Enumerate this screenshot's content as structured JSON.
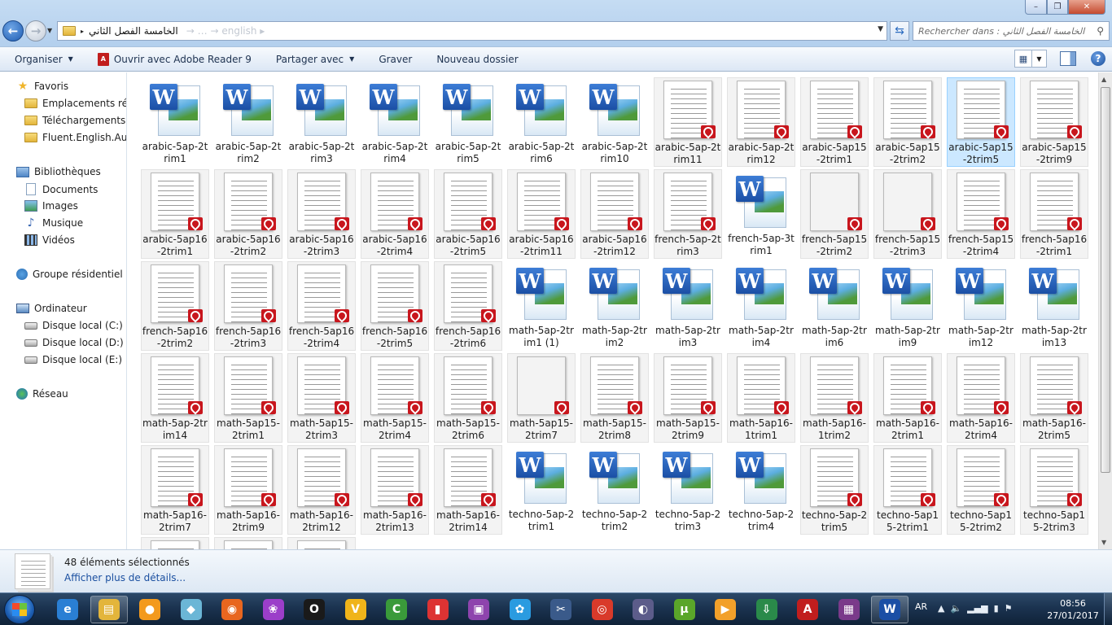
{
  "window": {
    "min_glyph": "–",
    "max_glyph": "❐",
    "close_glyph": "✕"
  },
  "address": {
    "path": "الخامسة الفصل الثاني",
    "ghost": "→ … → english ▸",
    "search_placeholder": "Rechercher dans : الخامسة الفصل الثاني"
  },
  "toolbar": {
    "organize": "Organiser",
    "open_with": "Ouvrir avec Adobe Reader 9",
    "share": "Partager avec",
    "burn": "Graver",
    "new_folder": "Nouveau dossier"
  },
  "sidebar": {
    "favorites": "Favoris",
    "recent": "Emplacements récents",
    "downloads": "Téléchargements",
    "fluent": "Fluent.English.Audio",
    "libraries": "Bibliothèques",
    "documents": "Documents",
    "images": "Images",
    "music": "Musique",
    "videos": "Vidéos",
    "homegroup": "Groupe résidentiel",
    "computer": "Ordinateur",
    "disk_c": "Disque local (C:)",
    "disk_d": "Disque local (D:)",
    "disk_e": "Disque local (E:)",
    "network": "Réseau"
  },
  "files": [
    {
      "name": "arabic-5ap-2trim1",
      "type": "word"
    },
    {
      "name": "arabic-5ap-2trim2",
      "type": "word"
    },
    {
      "name": "arabic-5ap-2trim3",
      "type": "word"
    },
    {
      "name": "arabic-5ap-2trim4",
      "type": "word"
    },
    {
      "name": "arabic-5ap-2trim5",
      "type": "word"
    },
    {
      "name": "arabic-5ap-2trim6",
      "type": "word"
    },
    {
      "name": "arabic-5ap-2trim10",
      "type": "word"
    },
    {
      "name": "arabic-5ap-2trim11",
      "type": "pdf"
    },
    {
      "name": "arabic-5ap-2trim12",
      "type": "pdf"
    },
    {
      "name": "arabic-5ap15-2trim1",
      "type": "pdf"
    },
    {
      "name": "arabic-5ap15-2trim2",
      "type": "pdf"
    },
    {
      "name": "arabic-5ap15-2trim5",
      "type": "pdf",
      "selected": true
    },
    {
      "name": "arabic-5ap15-2trim9",
      "type": "pdf"
    },
    {
      "name": "arabic-5ap16-2trim1",
      "type": "pdf"
    },
    {
      "name": "arabic-5ap16-2trim2",
      "type": "pdf"
    },
    {
      "name": "arabic-5ap16-2trim3",
      "type": "pdf"
    },
    {
      "name": "arabic-5ap16-2trim4",
      "type": "pdf"
    },
    {
      "name": "arabic-5ap16-2trim5",
      "type": "pdf"
    },
    {
      "name": "arabic-5ap16-2trim11",
      "type": "pdf"
    },
    {
      "name": "arabic-5ap16-2trim12",
      "type": "pdf"
    },
    {
      "name": "french-5ap-2trim3",
      "type": "pdf"
    },
    {
      "name": "french-5ap-3trim1",
      "type": "word"
    },
    {
      "name": "french-5ap15-2trim2",
      "type": "pdf",
      "thumb": "blue"
    },
    {
      "name": "french-5ap15-2trim3",
      "type": "pdf",
      "thumb": "green"
    },
    {
      "name": "french-5ap15-2trim4",
      "type": "pdf"
    },
    {
      "name": "french-5ap16-2trim1",
      "type": "pdf"
    },
    {
      "name": "french-5ap16-2trim2",
      "type": "pdf"
    },
    {
      "name": "french-5ap16-2trim3",
      "type": "pdf"
    },
    {
      "name": "french-5ap16-2trim4",
      "type": "pdf"
    },
    {
      "name": "french-5ap16-2trim5",
      "type": "pdf"
    },
    {
      "name": "french-5ap16-2trim6",
      "type": "pdf"
    },
    {
      "name": "math-5ap-2trim1 (1)",
      "type": "word"
    },
    {
      "name": "math-5ap-2trim2",
      "type": "word"
    },
    {
      "name": "math-5ap-2trim3",
      "type": "word"
    },
    {
      "name": "math-5ap-2trim4",
      "type": "word"
    },
    {
      "name": "math-5ap-2trim6",
      "type": "word"
    },
    {
      "name": "math-5ap-2trim9",
      "type": "word"
    },
    {
      "name": "math-5ap-2trim12",
      "type": "word"
    },
    {
      "name": "math-5ap-2trim13",
      "type": "word"
    },
    {
      "name": "math-5ap-2trim14",
      "type": "pdf"
    },
    {
      "name": "math-5ap15-2trim1",
      "type": "pdf"
    },
    {
      "name": "math-5ap15-2trim3",
      "type": "pdf"
    },
    {
      "name": "math-5ap15-2trim4",
      "type": "pdf"
    },
    {
      "name": "math-5ap15-2trim6",
      "type": "pdf"
    },
    {
      "name": "math-5ap15-2trim7",
      "type": "pdf",
      "thumb": "blue"
    },
    {
      "name": "math-5ap15-2trim8",
      "type": "pdf"
    },
    {
      "name": "math-5ap15-2trim9",
      "type": "pdf"
    },
    {
      "name": "math-5ap16-1trim1",
      "type": "pdf"
    },
    {
      "name": "math-5ap16-1trim2",
      "type": "pdf"
    },
    {
      "name": "math-5ap16-2trim1",
      "type": "pdf"
    },
    {
      "name": "math-5ap16-2trim4",
      "type": "pdf"
    },
    {
      "name": "math-5ap16-2trim5",
      "type": "pdf"
    },
    {
      "name": "math-5ap16-2trim7",
      "type": "pdf"
    },
    {
      "name": "math-5ap16-2trim9",
      "type": "pdf"
    },
    {
      "name": "math-5ap16-2trim12",
      "type": "pdf"
    },
    {
      "name": "math-5ap16-2trim13",
      "type": "pdf"
    },
    {
      "name": "math-5ap16-2trim14",
      "type": "pdf"
    },
    {
      "name": "techno-5ap-2trim1",
      "type": "word"
    },
    {
      "name": "techno-5ap-2trim2",
      "type": "word"
    },
    {
      "name": "techno-5ap-2trim3",
      "type": "word"
    },
    {
      "name": "techno-5ap-2trim4",
      "type": "word"
    },
    {
      "name": "techno-5ap-2trim5",
      "type": "pdf"
    },
    {
      "name": "techno-5ap15-2trim1",
      "type": "pdf"
    },
    {
      "name": "techno-5ap15-2trim2",
      "type": "pdf"
    },
    {
      "name": "techno-5ap15-2trim3",
      "type": "pdf"
    },
    {
      "name": "",
      "type": "pdf"
    },
    {
      "name": "",
      "type": "pdf"
    },
    {
      "name": "",
      "type": "pdf"
    }
  ],
  "details": {
    "count": "48 éléments sélectionnés",
    "more": "Afficher plus de détails..."
  },
  "taskbar": {
    "lang": "AR",
    "time": "08:56",
    "date": "27/01/2017",
    "apps": [
      {
        "icon": "internet-explorer-icon",
        "glyph": "e",
        "color": "#2a7fd4"
      },
      {
        "icon": "file-explorer-icon",
        "glyph": "▤",
        "color": "#e3b53b",
        "active": true
      },
      {
        "icon": "ball-app-icon",
        "glyph": "●",
        "color": "#f39a1e"
      },
      {
        "icon": "notes-app-icon",
        "glyph": "◆",
        "color": "#6bb6d6"
      },
      {
        "icon": "firefox-icon",
        "glyph": "◉",
        "color": "#e8661f"
      },
      {
        "icon": "picasa-icon",
        "glyph": "❀",
        "color": "#9b3ec9"
      },
      {
        "icon": "opera-icon",
        "glyph": "O",
        "color": "#1a1a1a"
      },
      {
        "icon": "v-app-icon",
        "glyph": "V",
        "color": "#f0b41a"
      },
      {
        "icon": "camtasia-icon",
        "glyph": "C",
        "color": "#3a9a3a"
      },
      {
        "icon": "usb-app-icon",
        "glyph": "▮",
        "color": "#d33"
      },
      {
        "icon": "form-app-icon",
        "glyph": "▣",
        "color": "#8e44ad"
      },
      {
        "icon": "shareit-icon",
        "glyph": "✿",
        "color": "#2a9be0"
      },
      {
        "icon": "scissors-icon",
        "glyph": "✂",
        "color": "#3a5a8a"
      },
      {
        "icon": "chrome-icon",
        "glyph": "◎",
        "color": "#d93a2a"
      },
      {
        "icon": "media-app-icon",
        "glyph": "◐",
        "color": "#5c5c8a"
      },
      {
        "icon": "utorrent-icon",
        "glyph": "µ",
        "color": "#5aa62a"
      },
      {
        "icon": "play-app-icon",
        "glyph": "▶",
        "color": "#f2a02a"
      },
      {
        "icon": "download-manager-icon",
        "glyph": "⇩",
        "color": "#2a8a4a"
      },
      {
        "icon": "adobe-reader-icon",
        "glyph": "A",
        "color": "#c11e1e"
      },
      {
        "icon": "winrar-icon",
        "glyph": "▦",
        "color": "#7a3a8a"
      },
      {
        "icon": "word-icon",
        "glyph": "W",
        "color": "#1b4fa5",
        "active": true
      }
    ]
  }
}
